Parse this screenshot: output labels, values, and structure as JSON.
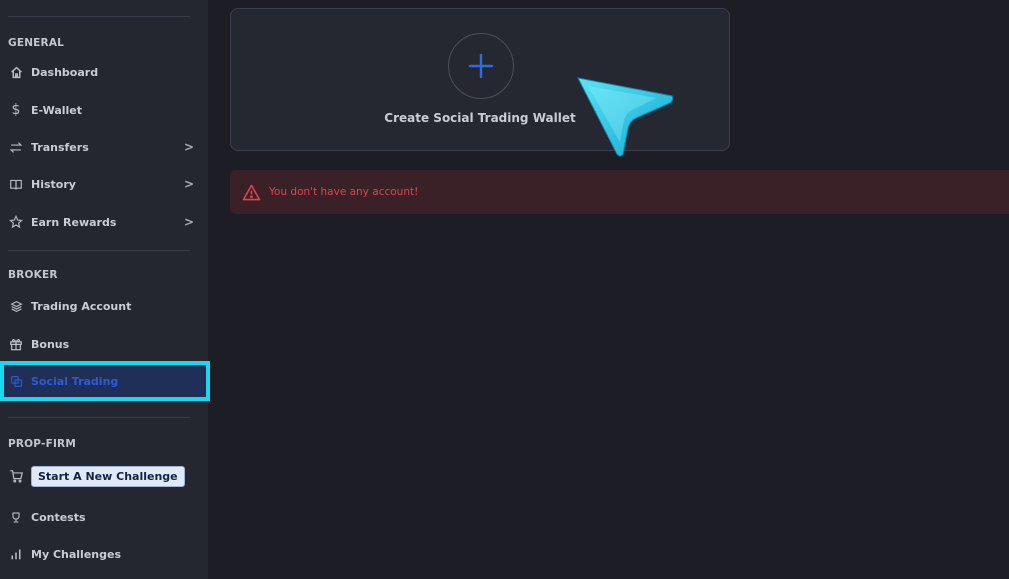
{
  "sidebar": {
    "general": {
      "title": "GENERAL",
      "items": [
        {
          "label": "Dashboard",
          "icon": "home-icon"
        },
        {
          "label": "E-Wallet",
          "icon": "dollar-icon"
        },
        {
          "label": "Transfers",
          "icon": "transfer-icon",
          "chevron": ">"
        },
        {
          "label": "History",
          "icon": "book-icon",
          "chevron": ">"
        },
        {
          "label": "Earn Rewards",
          "icon": "star-icon",
          "chevron": ">"
        }
      ]
    },
    "broker": {
      "title": "BROKER",
      "items": [
        {
          "label": "Trading Account",
          "icon": "layers-icon"
        },
        {
          "label": "Bonus",
          "icon": "gift-icon"
        },
        {
          "label": "Social Trading",
          "icon": "copy-icon",
          "active": true
        }
      ]
    },
    "prop_firm": {
      "title": "PROP-FIRM",
      "challenge_button": "Start A New Challenge",
      "items": [
        {
          "label": "Contests",
          "icon": "trophy-icon"
        },
        {
          "label": "My Challenges",
          "icon": "bar-chart-icon"
        }
      ]
    }
  },
  "main": {
    "create_wallet_label": "Create Social Trading Wallet",
    "alert_text": "You don't have any account!"
  },
  "colors": {
    "accent": "#19d9f0",
    "active_text": "#2d5bd6",
    "alert_text": "#e0434d",
    "alert_bg": "#3a2127"
  }
}
